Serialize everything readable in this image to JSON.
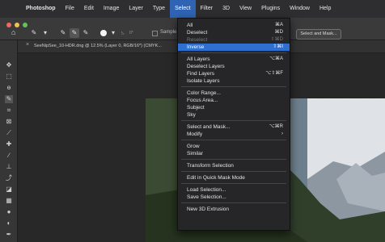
{
  "menubar": {
    "apple_glyph": "",
    "app_name": "Photoshop",
    "items": [
      "File",
      "Edit",
      "Image",
      "Layer",
      "Type",
      "Select",
      "Filter",
      "3D",
      "View",
      "Plugins",
      "Window",
      "Help"
    ],
    "active_index": 5
  },
  "options": {
    "feather_label": "0°",
    "sample_label": "Sample",
    "select_mask_button": "Select and Mask..."
  },
  "document_tab": {
    "label": "SeeNipSee_10-HDR.dng @ 12.5% (Layer 0, RGB/16*) (CMYK..."
  },
  "select_menu": [
    {
      "label": "All",
      "shortcut": "⌘A",
      "state": "normal"
    },
    {
      "label": "Deselect",
      "shortcut": "⌘D",
      "state": "normal"
    },
    {
      "label": "Reselect",
      "shortcut": "⇧⌘D",
      "state": "disabled"
    },
    {
      "label": "Inverse",
      "shortcut": "⇧⌘I",
      "state": "highlighted"
    },
    {
      "separator": true
    },
    {
      "label": "All Layers",
      "shortcut": "⌥⌘A",
      "state": "normal"
    },
    {
      "label": "Deselect Layers",
      "shortcut": "",
      "state": "normal"
    },
    {
      "label": "Find Layers",
      "shortcut": "⌥⇧⌘F",
      "state": "normal"
    },
    {
      "label": "Isolate Layers",
      "shortcut": "",
      "state": "normal"
    },
    {
      "separator": true
    },
    {
      "label": "Color Range...",
      "shortcut": "",
      "state": "normal"
    },
    {
      "label": "Focus Area...",
      "shortcut": "",
      "state": "normal"
    },
    {
      "label": "Subject",
      "shortcut": "",
      "state": "normal"
    },
    {
      "label": "Sky",
      "shortcut": "",
      "state": "normal"
    },
    {
      "separator": true
    },
    {
      "label": "Select and Mask...",
      "shortcut": "⌥⌘R",
      "state": "normal"
    },
    {
      "label": "Modify",
      "shortcut": "",
      "state": "submenu"
    },
    {
      "separator": true
    },
    {
      "label": "Grow",
      "shortcut": "",
      "state": "normal"
    },
    {
      "label": "Similar",
      "shortcut": "",
      "state": "normal"
    },
    {
      "separator": true
    },
    {
      "label": "Transform Selection",
      "shortcut": "",
      "state": "normal"
    },
    {
      "separator": true
    },
    {
      "label": "Edit in Quick Mask Mode",
      "shortcut": "",
      "state": "normal"
    },
    {
      "separator": true
    },
    {
      "label": "Load Selection...",
      "shortcut": "",
      "state": "normal"
    },
    {
      "label": "Save Selection...",
      "shortcut": "",
      "state": "normal"
    },
    {
      "separator": true
    },
    {
      "label": "New 3D Extrusion",
      "shortcut": "",
      "state": "normal"
    }
  ],
  "colors": {
    "menu_highlight": "#2f6fd0",
    "menubar_active": "#2f63b4"
  },
  "icons": {
    "toolbar": [
      "move-icon",
      "marquee-icon",
      "lasso-icon",
      "quick-select-icon",
      "crop-icon",
      "frame-icon",
      "eyedropper-icon",
      "healing-icon",
      "brush-icon",
      "stamp-icon",
      "history-brush-icon",
      "eraser-icon",
      "gradient-icon",
      "blur-icon",
      "dodge-icon",
      "pen-icon",
      "type-icon"
    ]
  }
}
